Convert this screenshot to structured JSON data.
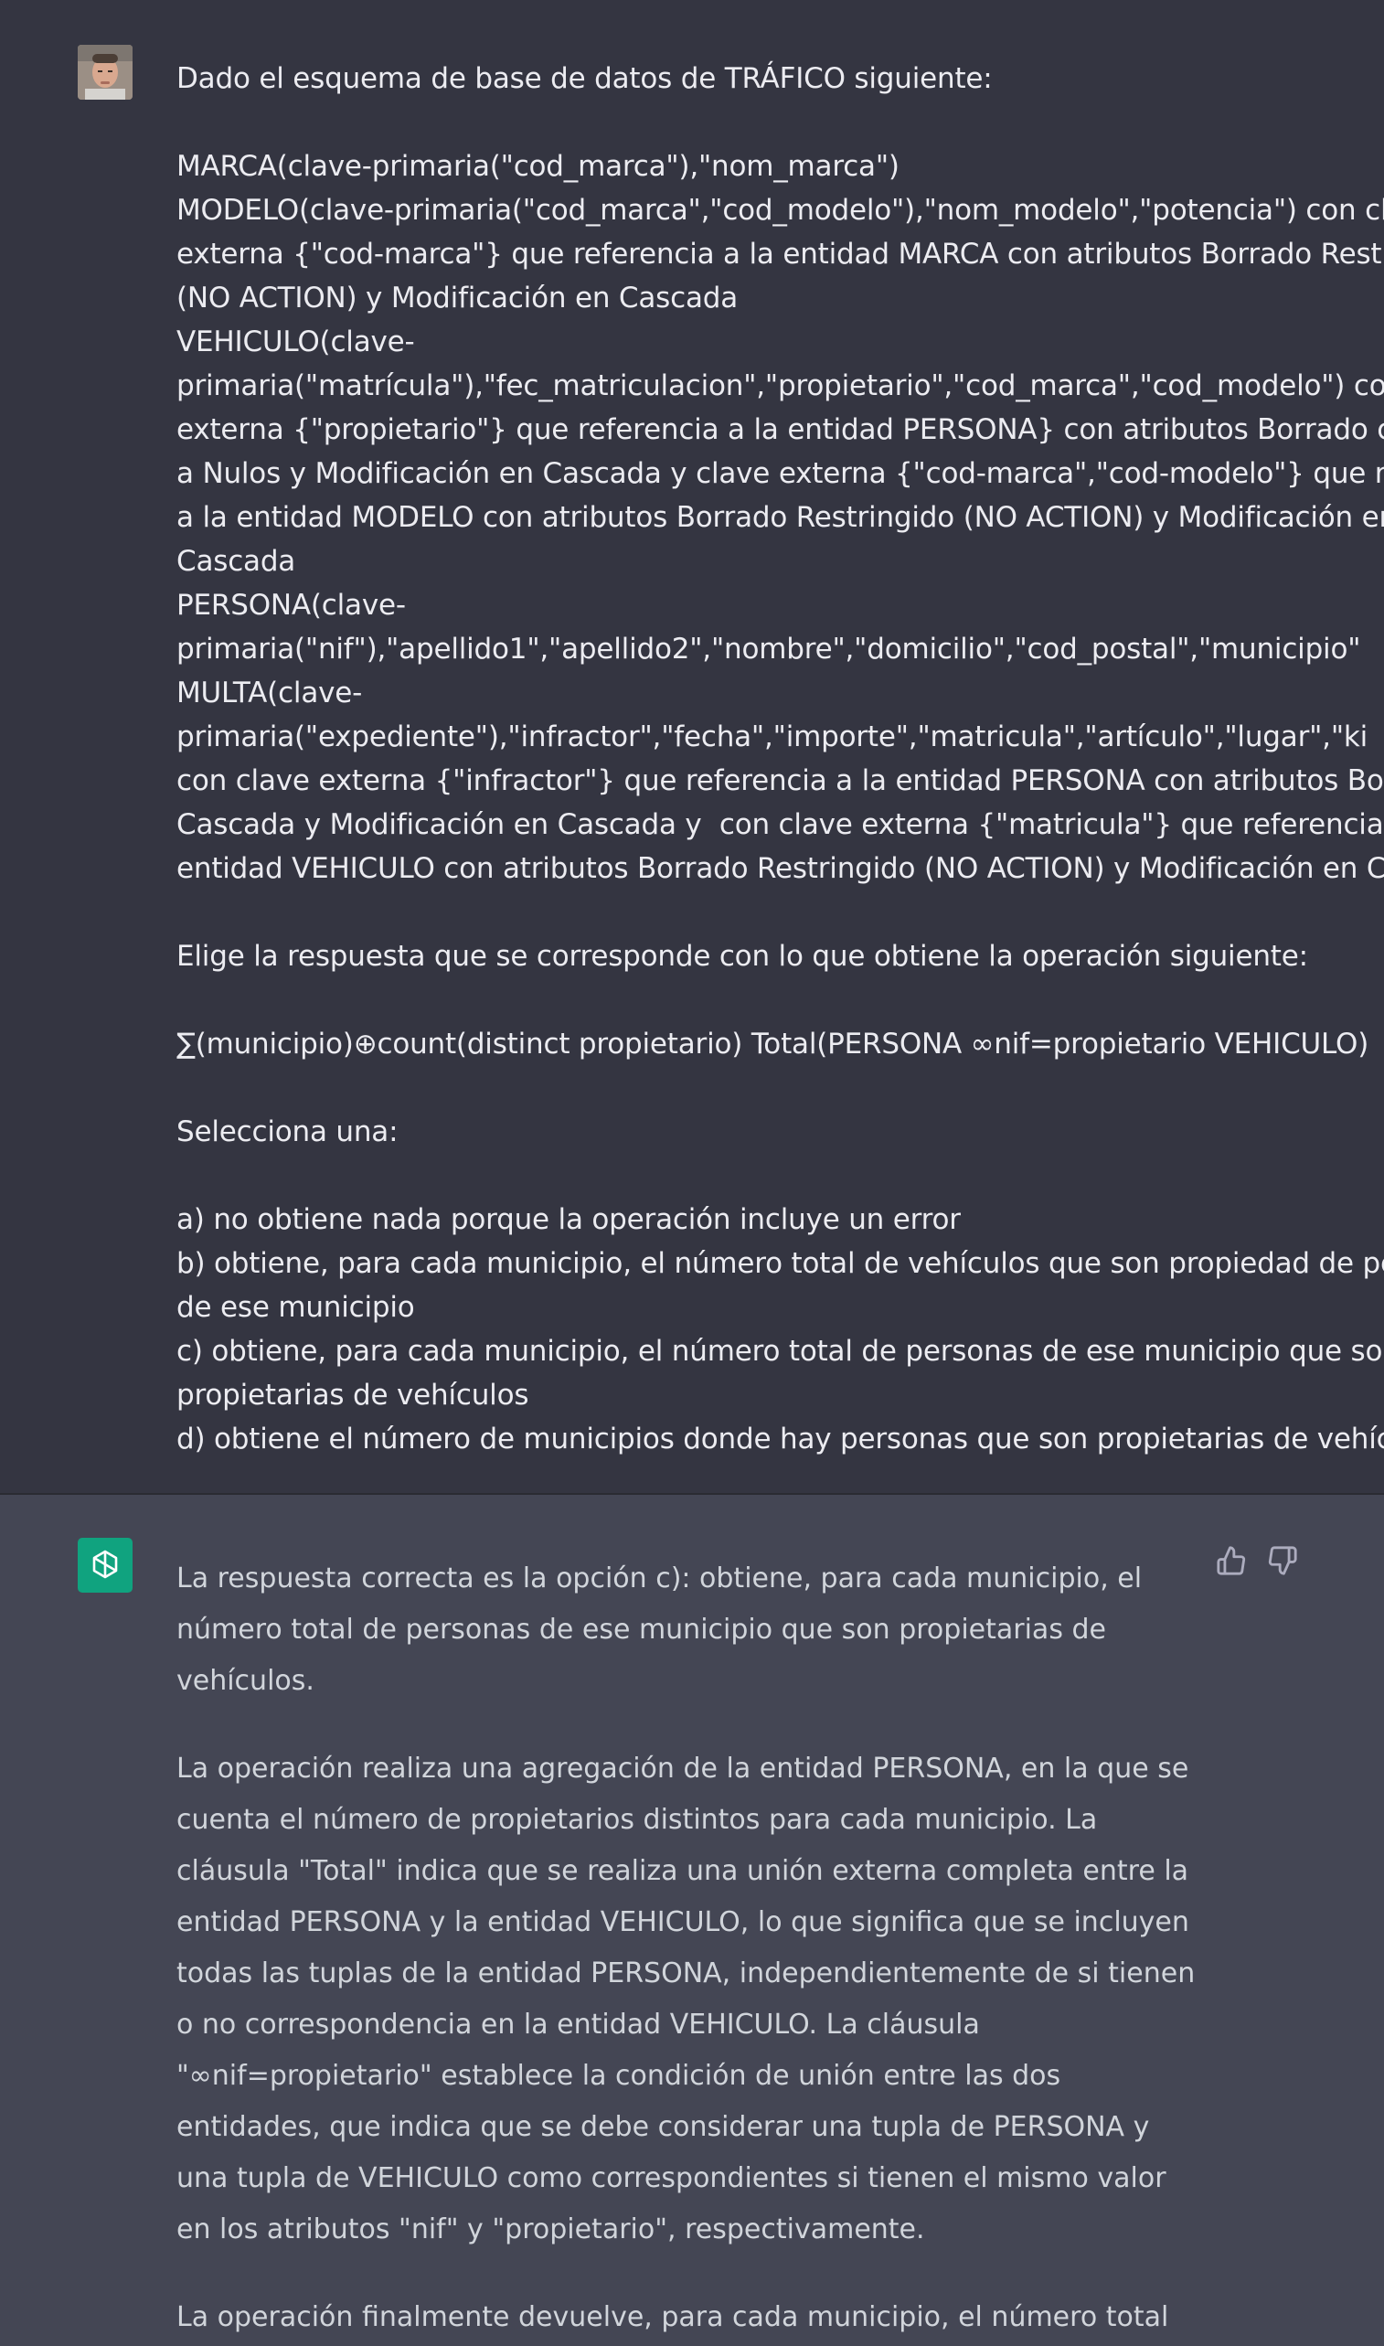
{
  "user_message": {
    "avatar": "user-photo",
    "lines": [
      "Dado el esquema de base de datos de TRÁFICO siguiente:",
      "",
      "MARCA(clave-primaria(\"cod_marca\"),\"nom_marca\")",
      "MODELO(clave-primaria(\"cod_marca\",\"cod_modelo\"),\"nom_modelo\",\"potencia\") con cl",
      "externa {\"cod-marca\"} que referencia a la entidad MARCA con atributos Borrado Restrin",
      "(NO ACTION) y Modificación en Cascada",
      "VEHICULO(clave-",
      "primaria(\"matrícula\"),\"fec_matriculacion\",\"propietario\",\"cod_marca\",\"cod_modelo\") con",
      "externa {\"propietario\"} que referencia a la entidad PERSONA} con atributos Borrado con",
      "a Nulos y Modificación en Cascada y clave externa {\"cod-marca\",\"cod-modelo\"} que ref",
      "a la entidad MODELO con atributos Borrado Restringido (NO ACTION) y Modificación en",
      "Cascada",
      "PERSONA(clave-",
      "primaria(\"nif\"),\"apellido1\",\"apellido2\",\"nombre\",\"domicilio\",\"cod_postal\",\"municipio\"",
      "MULTA(clave-",
      "primaria(\"expediente\"),\"infractor\",\"fecha\",\"importe\",\"matricula\",\"artículo\",\"lugar\",\"ki",
      "con clave externa {\"infractor\"} que referencia a la entidad PERSONA con atributos Borra",
      "Cascada y Modificación en Cascada y  con clave externa {\"matricula\"} que referencia a l",
      "entidad VEHICULO con atributos Borrado Restringido (NO ACTION) y Modificación en C",
      "",
      "Elige la respuesta que se corresponde con lo que obtiene la operación siguiente:",
      "",
      "∑(municipio)⊕count(distinct propietario) Total(PERSONA ∞nif=propietario VEHICULO)",
      "",
      "Selecciona una:",
      "",
      "a) no obtiene nada porque la operación incluye un error",
      "b) obtiene, para cada municipio, el número total de vehículos que son propiedad de pers",
      "de ese municipio",
      "c) obtiene, para cada municipio, el número total de personas de ese municipio que son",
      "propietarias de vehículos",
      "d) obtiene el número de municipios donde hay personas que son propietarias de vehícu"
    ]
  },
  "assistant_message": {
    "avatar": "openai-logo-icon",
    "paragraphs": [
      "La respuesta correcta es la opción c): obtiene, para cada municipio, el número total de personas de ese municipio que son propietarias de vehículos.",
      "La operación realiza una agregación de la entidad PERSONA, en la que se cuenta el número de propietarios distintos para cada municipio. La cláusula \"Total\" indica que se realiza una unión externa completa entre la entidad PERSONA y la entidad VEHICULO, lo que significa que se incluyen todas las tuplas de la entidad PERSONA, independientemente de si tienen o no correspondencia en la entidad VEHICULO. La cláusula \"∞nif=propietario\" establece la condición de unión entre las dos entidades, que indica que se debe considerar una tupla de PERSONA y una tupla de VEHICULO como correspondientes si tienen el mismo valor en los atributos \"nif\" y \"propietario\", respectivamente.",
      "La operación finalmente devuelve, para cada municipio, el número total"
    ],
    "feedback_icons": [
      "thumbs-up-icon",
      "thumbs-down-icon"
    ]
  },
  "colors": {
    "user_bg": "#343541",
    "assistant_bg": "#444654",
    "user_text": "#ececf1",
    "assistant_text": "#d1d5db",
    "gpt_avatar": "#10a37f"
  }
}
